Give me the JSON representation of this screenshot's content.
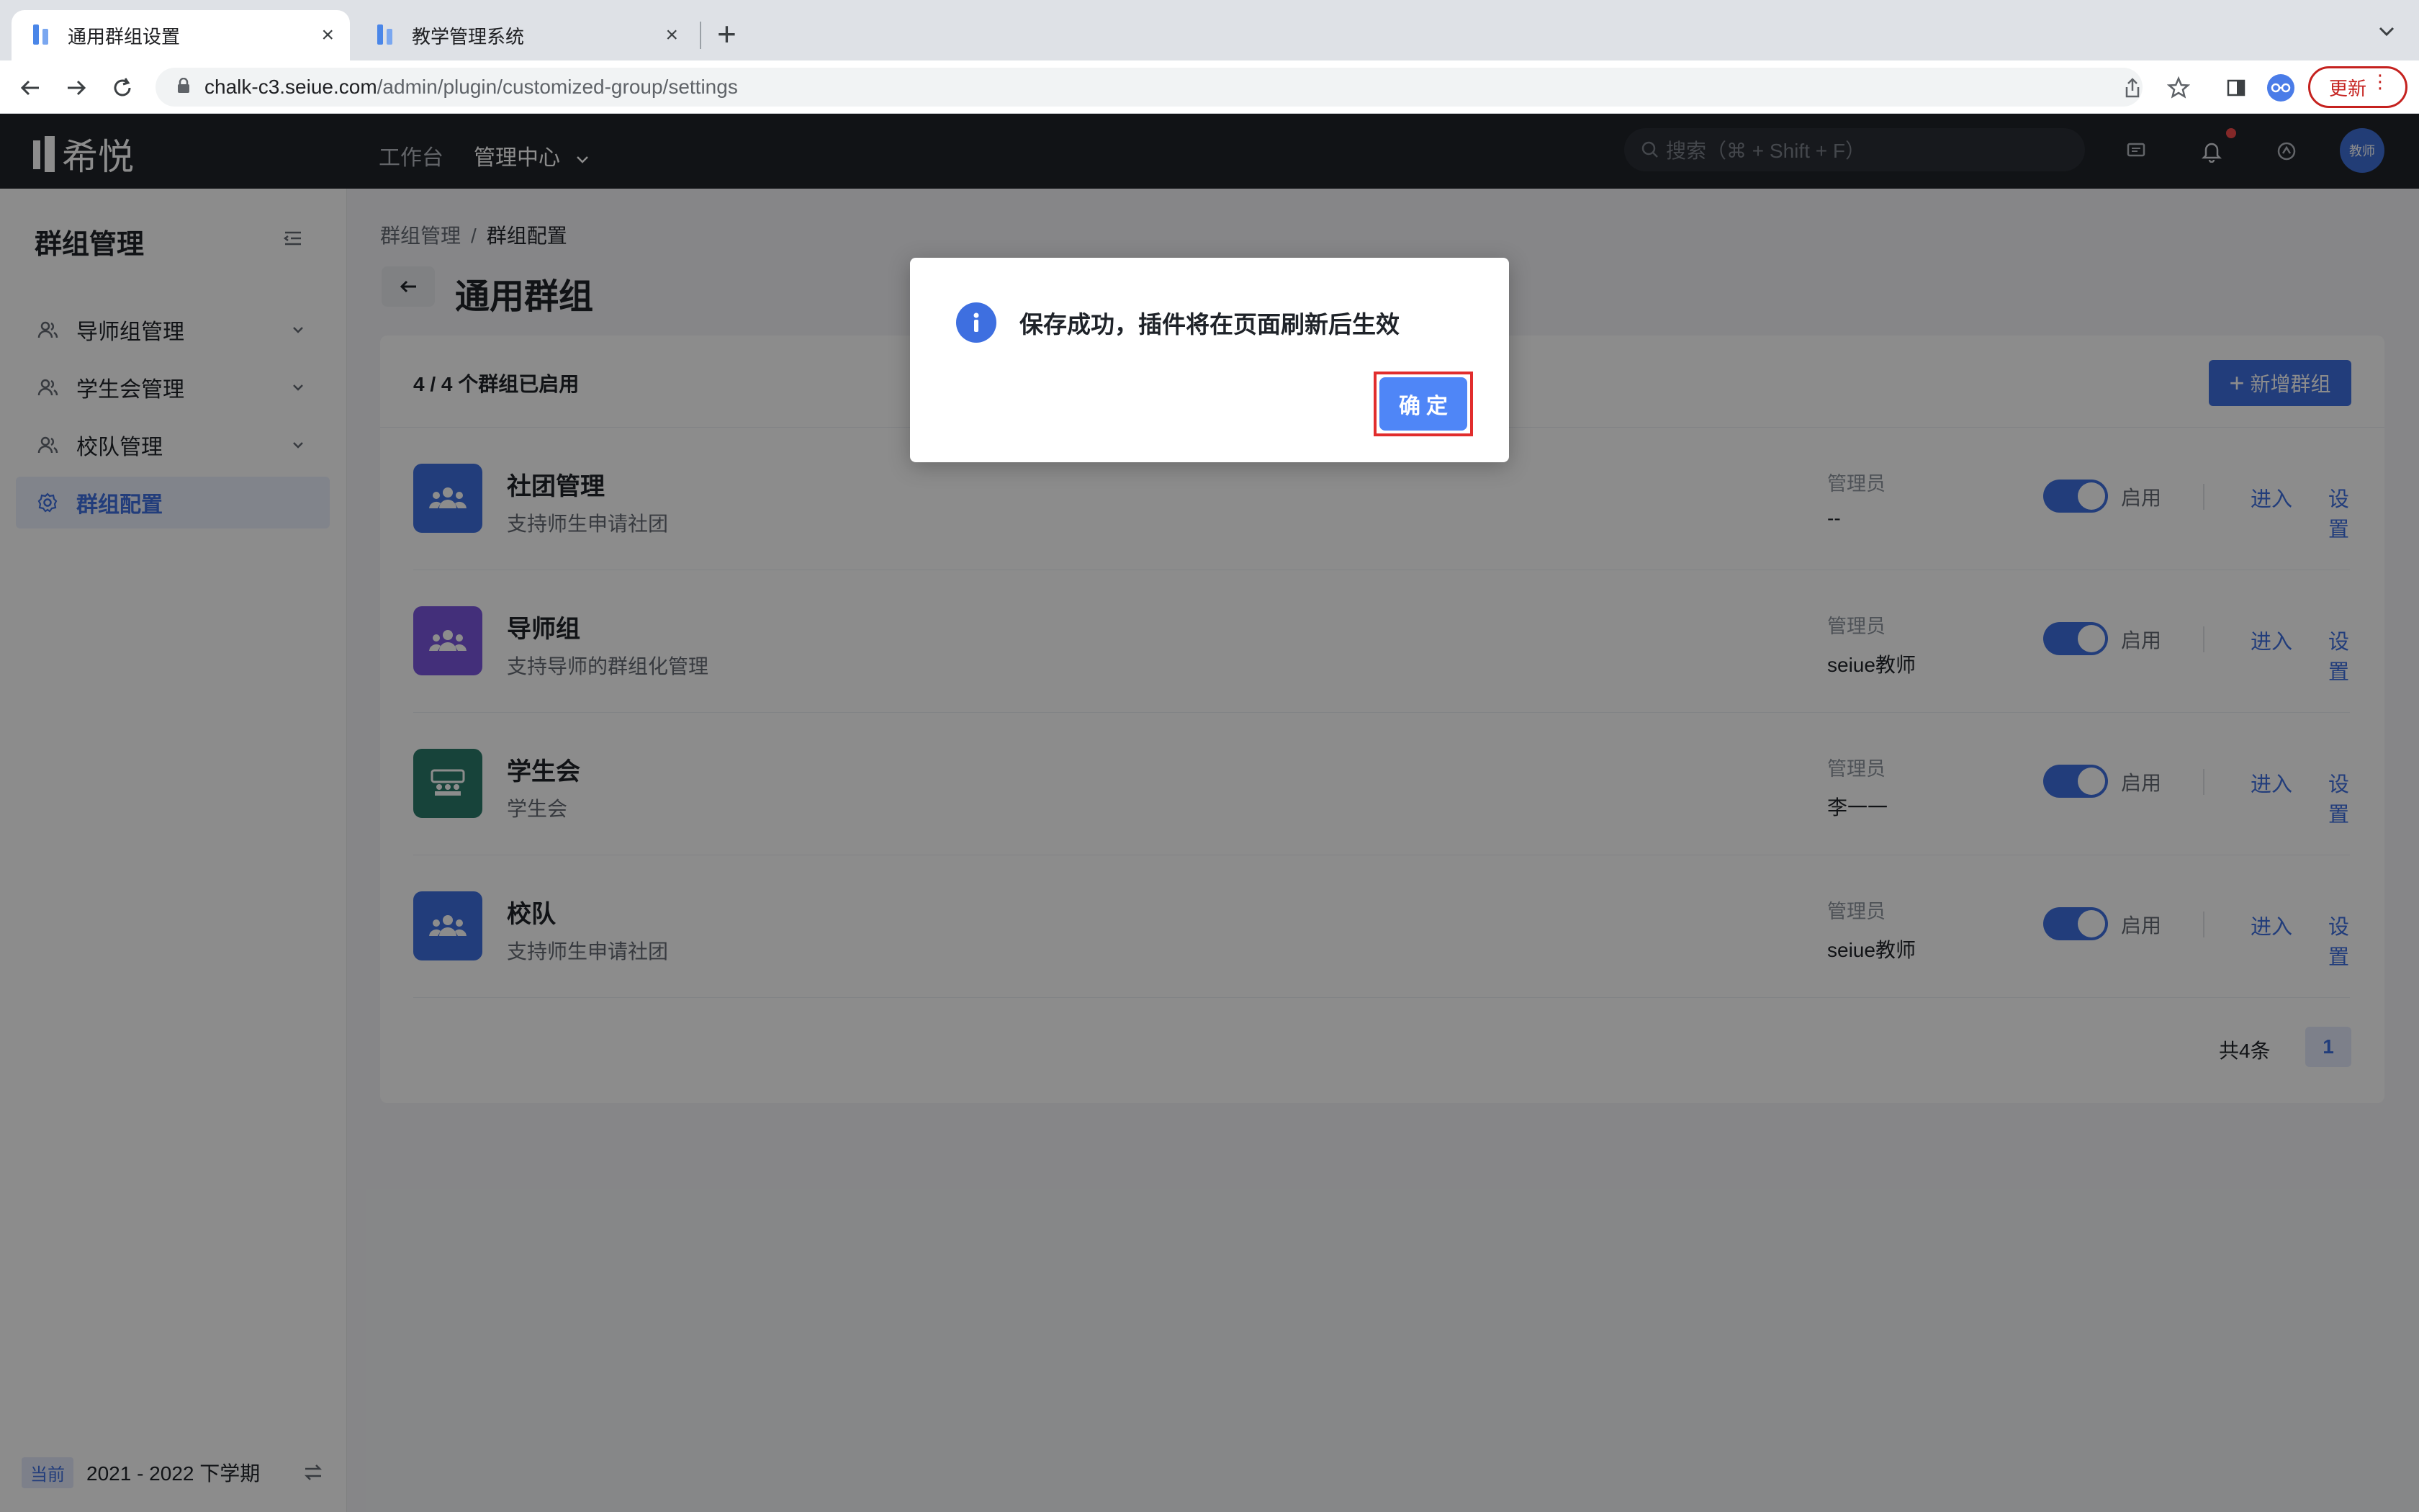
{
  "browser": {
    "tabs": [
      {
        "title": "通用群组设置"
      },
      {
        "title": "教学管理系统"
      }
    ],
    "url_host": "chalk-c3.seiue.com",
    "url_path": "/admin/plugin/customized-group/settings",
    "update_label": "更新"
  },
  "header": {
    "logo_text": "希悦",
    "nav": [
      "工作台",
      "管理中心"
    ],
    "search_placeholder": "搜索（⌘ + Shift + F）",
    "avatar_text": "教师"
  },
  "sidebar": {
    "title": "群组管理",
    "items": [
      {
        "label": "导师组管理"
      },
      {
        "label": "学生会管理"
      },
      {
        "label": "校队管理"
      },
      {
        "label": "群组配置"
      }
    ],
    "footer_tag": "当前",
    "footer_term": "2021 - 2022 下学期"
  },
  "breadcrumb": [
    "群组管理",
    "/",
    "群组配置"
  ],
  "page_title": "通用群组",
  "summary": "4 / 4 个群组已启用",
  "add_button": "新增群组",
  "admin_label": "管理员",
  "toggle_label": "启用",
  "enter_label": "进入",
  "settings_label": "设置",
  "groups": [
    {
      "name": "社团管理",
      "desc": "支持师生申请社团",
      "admin": "--",
      "color": "#3e6fe0"
    },
    {
      "name": "导师组",
      "desc": "支持导师的群组化管理",
      "admin": "seiue教师",
      "color": "#7b56de"
    },
    {
      "name": "学生会",
      "desc": "学生会",
      "admin": "李一一",
      "color": "#2b7a6a"
    },
    {
      "name": "校队",
      "desc": "支持师生申请社团",
      "admin": "seiue教师",
      "color": "#3e6fe0"
    }
  ],
  "pagination": {
    "total": "共4条",
    "current": "1"
  },
  "dialog": {
    "message": "保存成功，插件将在页面刷新后生效",
    "ok": "确定"
  }
}
